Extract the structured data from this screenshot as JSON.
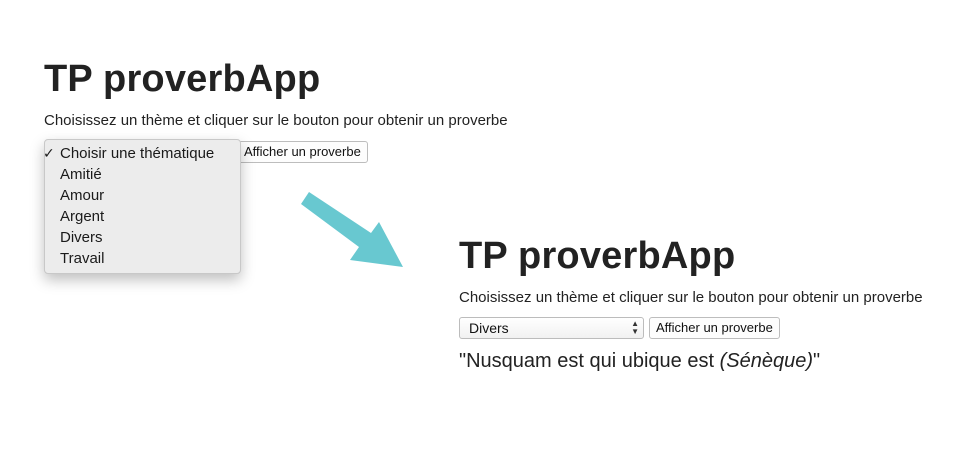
{
  "app": {
    "title": "TP proverbApp"
  },
  "instructions": "Choisissez un thème et cliquer sur le bouton pour obtenir un proverbe",
  "theme_select": {
    "options": [
      "Choisir une thématique",
      "Amitié",
      "Amour",
      "Argent",
      "Divers",
      "Travail"
    ],
    "checked_option": "Choisir une thématique",
    "check_mark": "✓",
    "selected_after": "Divers"
  },
  "button": {
    "label": "Afficher un proverbe"
  },
  "result": {
    "quote_open": "\"",
    "text": "Nusquam est qui ubique est ",
    "author": "(Sénèque)",
    "quote_close": "\""
  },
  "colors": {
    "arrow": "#68c8d0"
  },
  "icons": {
    "select_arrows": "chevron-up-down-icon",
    "transition_arrow": "arrow-icon",
    "checkmark": "checkmark-icon"
  }
}
